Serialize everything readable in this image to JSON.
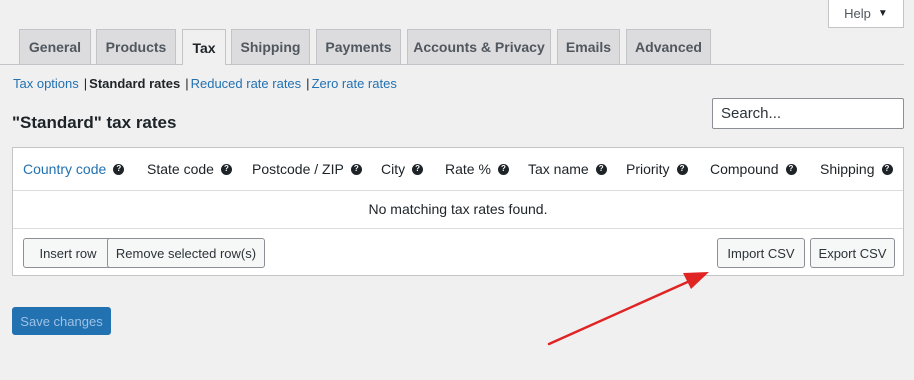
{
  "help": {
    "label": "Help",
    "caret": "▼"
  },
  "tabs": [
    {
      "label": "General",
      "active": false
    },
    {
      "label": "Products",
      "active": false
    },
    {
      "label": "Tax",
      "active": true
    },
    {
      "label": "Shipping",
      "active": false
    },
    {
      "label": "Payments",
      "active": false
    },
    {
      "label": "Accounts & Privacy",
      "active": false
    },
    {
      "label": "Emails",
      "active": false
    },
    {
      "label": "Advanced",
      "active": false
    }
  ],
  "sections": {
    "tax_options": "Tax options",
    "standard_rates": "Standard rates",
    "reduced_rate_rates": "Reduced rate rates",
    "zero_rate_rates": "Zero rate rates",
    "separator": "|"
  },
  "page_title": "\"Standard\" tax rates",
  "search": {
    "placeholder": "Search..."
  },
  "table": {
    "columns": [
      {
        "label": "Country code"
      },
      {
        "label": "State code"
      },
      {
        "label": "Postcode / ZIP"
      },
      {
        "label": "City"
      },
      {
        "label": "Rate %"
      },
      {
        "label": "Tax name"
      },
      {
        "label": "Priority"
      },
      {
        "label": "Compound"
      },
      {
        "label": "Shipping"
      }
    ],
    "help_icon": "?",
    "empty_message": "No matching tax rates found."
  },
  "actions": {
    "insert_row": "Insert row",
    "remove_selected": "Remove selected row(s)",
    "import_csv": "Import CSV",
    "export_csv": "Export CSV"
  },
  "save_changes": "Save changes",
  "colors": {
    "link": "#2271b1",
    "primary": "#2271b1",
    "annotation_arrow": "#e02424"
  },
  "icons": {
    "help_caret": "caret-down-icon",
    "column_help": "question-circle-icon",
    "annotation": "arrow-annotation"
  }
}
